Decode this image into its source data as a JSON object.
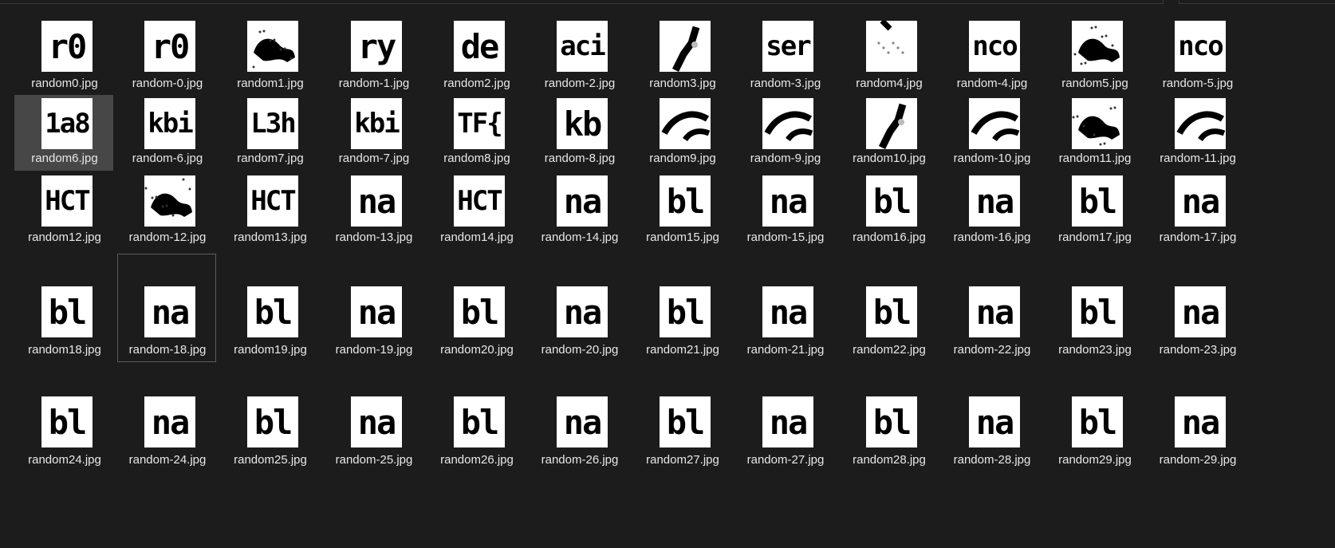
{
  "folder_view": {
    "rows": [
      [
        {
          "name": "random0.jpg",
          "text": "r0",
          "style": "text"
        },
        {
          "name": "random-0.jpg",
          "text": "r0",
          "style": "text"
        },
        {
          "name": "random1.jpg",
          "text": "",
          "style": "blob"
        },
        {
          "name": "random-1.jpg",
          "text": "ry",
          "style": "text"
        },
        {
          "name": "random2.jpg",
          "text": "de",
          "style": "text"
        },
        {
          "name": "random-2.jpg",
          "text": "aci",
          "style": "text"
        },
        {
          "name": "random3.jpg",
          "text": "",
          "style": "stroke"
        },
        {
          "name": "random-3.jpg",
          "text": "ser",
          "style": "text"
        },
        {
          "name": "random4.jpg",
          "text": "",
          "style": "sparse"
        },
        {
          "name": "random-4.jpg",
          "text": "nco",
          "style": "text"
        },
        {
          "name": "random5.jpg",
          "text": "",
          "style": "blob"
        },
        {
          "name": "random-5.jpg",
          "text": "nco",
          "style": "text"
        }
      ],
      [
        {
          "name": "random6.jpg",
          "text": "1a8",
          "style": "text",
          "selected": true
        },
        {
          "name": "random-6.jpg",
          "text": "kbi",
          "style": "text"
        },
        {
          "name": "random7.jpg",
          "text": "L3h",
          "style": "text"
        },
        {
          "name": "random-7.jpg",
          "text": "kbi",
          "style": "text"
        },
        {
          "name": "random8.jpg",
          "text": "TF{",
          "style": "text"
        },
        {
          "name": "random-8.jpg",
          "text": "kb",
          "style": "text"
        },
        {
          "name": "random9.jpg",
          "text": "",
          "style": "curve"
        },
        {
          "name": "random-9.jpg",
          "text": "",
          "style": "curve"
        },
        {
          "name": "random10.jpg",
          "text": "",
          "style": "stroke"
        },
        {
          "name": "random-10.jpg",
          "text": "",
          "style": "curve"
        },
        {
          "name": "random11.jpg",
          "text": "",
          "style": "blob"
        },
        {
          "name": "random-11.jpg",
          "text": "",
          "style": "curve"
        }
      ],
      [
        {
          "name": "random12.jpg",
          "text": "HCT",
          "style": "text"
        },
        {
          "name": "random-12.jpg",
          "text": "",
          "style": "blob"
        },
        {
          "name": "random13.jpg",
          "text": "HCT",
          "style": "text"
        },
        {
          "name": "random-13.jpg",
          "text": "na",
          "style": "text"
        },
        {
          "name": "random14.jpg",
          "text": "HCT",
          "style": "text"
        },
        {
          "name": "random-14.jpg",
          "text": "na",
          "style": "text"
        },
        {
          "name": "random15.jpg",
          "text": "bl",
          "style": "text"
        },
        {
          "name": "random-15.jpg",
          "text": "na",
          "style": "text"
        },
        {
          "name": "random16.jpg",
          "text": "bl",
          "style": "text"
        },
        {
          "name": "random-16.jpg",
          "text": "na",
          "style": "text"
        },
        {
          "name": "random17.jpg",
          "text": "bl",
          "style": "text"
        },
        {
          "name": "random-17.jpg",
          "text": "na",
          "style": "text"
        }
      ],
      [
        {
          "name": "random18.jpg",
          "text": "bl",
          "style": "text"
        },
        {
          "name": "random-18.jpg",
          "text": "na",
          "style": "text",
          "focused": true
        },
        {
          "name": "random19.jpg",
          "text": "bl",
          "style": "text"
        },
        {
          "name": "random-19.jpg",
          "text": "na",
          "style": "text"
        },
        {
          "name": "random20.jpg",
          "text": "bl",
          "style": "text"
        },
        {
          "name": "random-20.jpg",
          "text": "na",
          "style": "text"
        },
        {
          "name": "random21.jpg",
          "text": "bl",
          "style": "text"
        },
        {
          "name": "random-21.jpg",
          "text": "na",
          "style": "text"
        },
        {
          "name": "random22.jpg",
          "text": "bl",
          "style": "text"
        },
        {
          "name": "random-22.jpg",
          "text": "na",
          "style": "text"
        },
        {
          "name": "random23.jpg",
          "text": "bl",
          "style": "text"
        },
        {
          "name": "random-23.jpg",
          "text": "na",
          "style": "text"
        }
      ],
      [
        {
          "name": "random24.jpg",
          "text": "bl",
          "style": "text"
        },
        {
          "name": "random-24.jpg",
          "text": "na",
          "style": "text"
        },
        {
          "name": "random25.jpg",
          "text": "bl",
          "style": "text"
        },
        {
          "name": "random-25.jpg",
          "text": "na",
          "style": "text"
        },
        {
          "name": "random26.jpg",
          "text": "bl",
          "style": "text"
        },
        {
          "name": "random-26.jpg",
          "text": "na",
          "style": "text"
        },
        {
          "name": "random27.jpg",
          "text": "bl",
          "style": "text"
        },
        {
          "name": "random-27.jpg",
          "text": "na",
          "style": "text"
        },
        {
          "name": "random28.jpg",
          "text": "bl",
          "style": "text"
        },
        {
          "name": "random-28.jpg",
          "text": "na",
          "style": "text"
        },
        {
          "name": "random29.jpg",
          "text": "bl",
          "style": "text"
        },
        {
          "name": "random-29.jpg",
          "text": "na",
          "style": "text"
        }
      ]
    ]
  },
  "colors": {
    "background": "#1c1c1c",
    "selected_tile": "#474747",
    "focus_border": "#5d5d5d",
    "filename_text": "#e8e8e8",
    "thumbnail_bg": "#ffffff",
    "ink": "#000000"
  }
}
